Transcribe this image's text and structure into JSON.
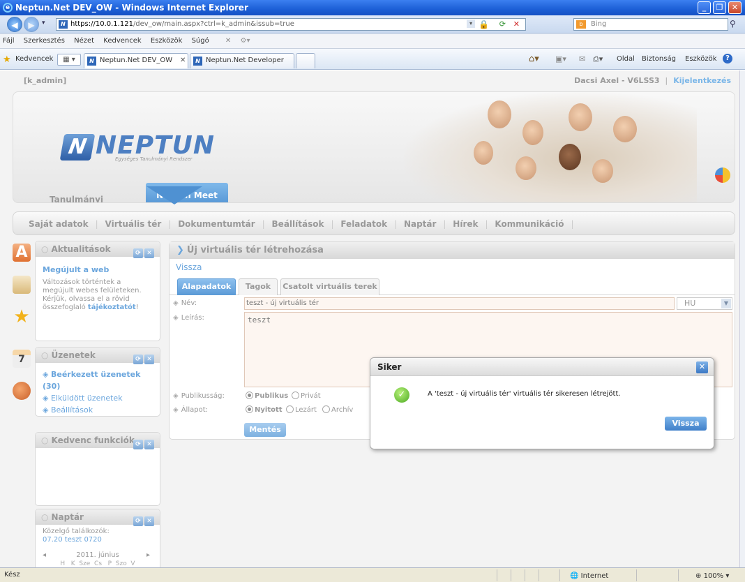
{
  "window": {
    "title": "Neptun.Net DEV_OW - Windows Internet Explorer"
  },
  "address": {
    "protocol": "https://",
    "host": "10.0.1.121",
    "path": "/dev_ow/main.aspx?ctrl=k_admin&issub=true",
    "search_placeholder": "Bing"
  },
  "menu": [
    "Fájl",
    "Szerkesztés",
    "Nézet",
    "Kedvencek",
    "Eszközök",
    "Súgó"
  ],
  "favorites": {
    "label": "Kedvencek",
    "tabs": [
      "Neptun.Net DEV_OW",
      "Neptun.Net Developer"
    ],
    "tools": [
      "Oldal",
      "Biztonság",
      "Eszközök"
    ]
  },
  "page": {
    "user_code": "[k_admin]",
    "user_name": "Dacsi Axel - V6LSS3",
    "logout": "Kijelentkezés",
    "logo_text": "NEPTUN",
    "logo_sub": "Egységes Tanulmányi Rendszer",
    "top_tabs": [
      "Tanulmányi rendszer",
      "Neptun Meet Street"
    ],
    "nav": [
      "Saját adatok",
      "Virtuális tér",
      "Dokumentumtár",
      "Beállítások",
      "Feladatok",
      "Naptár",
      "Hírek",
      "Kommunikáció"
    ]
  },
  "boxes": {
    "news": {
      "title": "Aktualitások",
      "headline": "Megújult a web",
      "body": "Változások történtek a megújult webes felületeken. Kérjük, olvassa el a rövid összefoglaló",
      "link": "tájékoztatót",
      "suffix": "!"
    },
    "messages": {
      "title": "Üzenetek",
      "items": [
        "Beérkezett üzenetek (30)",
        "Elküldött üzenetek",
        "Beállítások"
      ]
    },
    "favorites": {
      "title": "Kedvenc funkciók"
    },
    "calendar": {
      "title": "Naptár",
      "upcoming_label": "Közelgő találkozók:",
      "upcoming": "07.20 teszt 0720",
      "month": "2011. június",
      "days": "H   K  Sze  Cs   P  Szo  V"
    }
  },
  "main": {
    "title": "Új virtuális tér létrehozása",
    "back": "Vissza",
    "tabs": [
      "Alapadatok",
      "Tagok",
      "Csatolt virtuális terek"
    ],
    "fields": {
      "name_label": "Név:",
      "name_value": "teszt - új virtuális tér",
      "lang": "HU",
      "desc_label": "Leírás:",
      "desc_value": "teszt",
      "publicity_label": "Publikusság:",
      "publicity_options": [
        "Publikus",
        "Privát"
      ],
      "state_label": "Állapot:",
      "state_options": [
        "Nyitott",
        "Lezárt",
        "Archív"
      ]
    },
    "save": "Mentés"
  },
  "dialog": {
    "title": "Siker",
    "message": "A 'teszt - új virtuális tér' virtuális tér sikeresen létrejött.",
    "button": "Vissza"
  },
  "statusbar": {
    "left": "Kész",
    "zone": "Internet",
    "zoom": "100%"
  }
}
